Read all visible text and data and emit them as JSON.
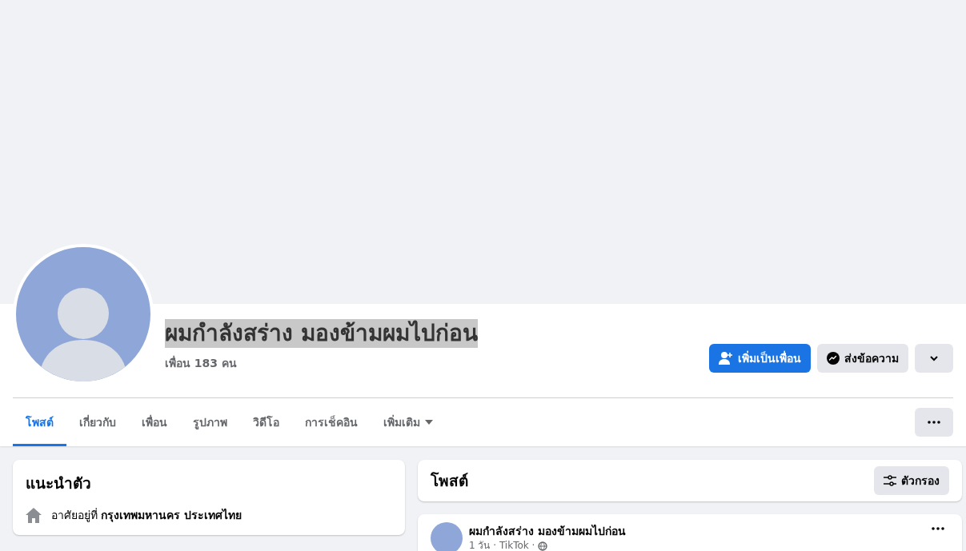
{
  "profile": {
    "name": "ผมกำลังสร่าง มองข้ามผมไปก่อน",
    "name_highlighted": true,
    "friends": "เพื่อน 183 คน"
  },
  "actions": [
    {
      "kind": "primary",
      "label": "เพิ่มเป็นเพื่อน"
    },
    {
      "kind": "secondary",
      "label": "ส่งข้อความ"
    },
    {
      "kind": "menu"
    }
  ],
  "tabs": [
    {
      "label": "โพสต์",
      "selected": true
    },
    {
      "label": "เกี่ยวกับ",
      "selected": false
    },
    {
      "label": "เพื่อน",
      "selected": false
    },
    {
      "label": "รูปภาพ",
      "selected": false
    },
    {
      "label": "วิดีโอ",
      "selected": false
    },
    {
      "label": "การเช็คอิน",
      "selected": false
    },
    {
      "label": "เพิ่มเติม",
      "selected": false,
      "dropdown": true
    }
  ],
  "intro": {
    "title": "แนะนำตัว",
    "lives_in": "อาศัยอยู่ที่ **กรุงเทพมหานคร ประเทศไทย**"
  },
  "posts_header": {
    "title": "โพสต์",
    "filter": "ตัวกรอง"
  },
  "post": {
    "author": "ผมกำลังสร่าง มองข้ามผมไปก่อน",
    "meta": "1 วัน · TikTok ·"
  }
}
